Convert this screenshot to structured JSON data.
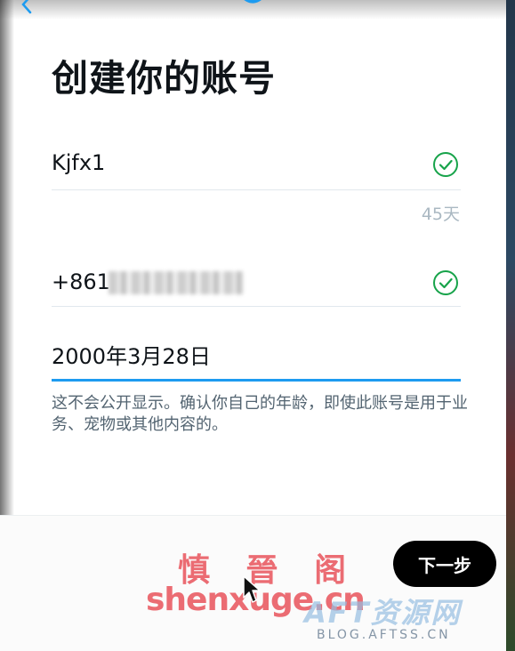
{
  "title": "创建你的账号",
  "name_field": {
    "value": "Kjfx1",
    "char_count": "45天"
  },
  "phone_field": {
    "prefix": "+861"
  },
  "birth_field": {
    "value": "2000年3月28日"
  },
  "helper_text": "这不会公开显示。确认你自己的年龄，即使此账号是用于业务、宠物或其他内容的。",
  "footer": {
    "next_label": "下一步"
  },
  "watermarks": {
    "cn": "慎 晉 阁",
    "en": "shenxuge.cn",
    "aft": "AFT资源网",
    "url": "BLOG.AFTSS.CN"
  },
  "colors": {
    "accent": "#1d9bf0",
    "check": "#17a34a",
    "button": "#000000"
  },
  "icons": [
    "back-arrow-icon",
    "bird-logo-icon",
    "check-circle-icon",
    "mouse-cursor-icon"
  ]
}
